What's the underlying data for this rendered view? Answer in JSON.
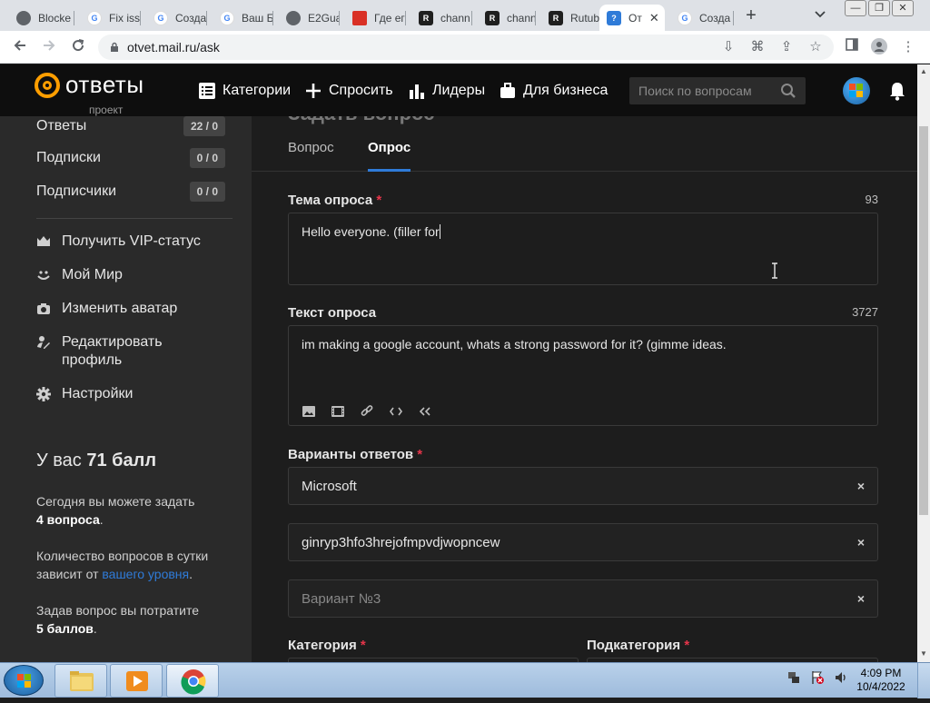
{
  "browser": {
    "tabs": [
      {
        "label": "Blocke",
        "color": "#5f6368",
        "letter": ""
      },
      {
        "label": "Fix iss",
        "color": "#4285f4",
        "letter": "G"
      },
      {
        "label": "Созда",
        "color": "#4285f4",
        "letter": "G"
      },
      {
        "label": "Ваш Б",
        "color": "#4285f4",
        "letter": "G"
      },
      {
        "label": "E2Gua",
        "color": "#5f6368",
        "letter": ""
      },
      {
        "label": "Где ег",
        "color": "#d93025",
        "letter": ""
      },
      {
        "label": "chann",
        "color": "#1f1f1f",
        "letter": "R"
      },
      {
        "label": "chann",
        "color": "#1f1f1f",
        "letter": "R"
      },
      {
        "label": "Rutub",
        "color": "#1f1f1f",
        "letter": "R"
      },
      {
        "label": "От",
        "color": "#2f7bd8",
        "letter": "?"
      },
      {
        "label": "Созда",
        "color": "#4285f4",
        "letter": "G"
      }
    ],
    "active_tab_close": "✕",
    "new_tab": "+",
    "url": "otvet.mail.ru/ask"
  },
  "header": {
    "logo_text": "ответы",
    "logo_sub": "проект",
    "nav": {
      "categories": "Категории",
      "ask": "Спросить",
      "leaders": "Лидеры",
      "business": "Для бизнеса"
    },
    "search_placeholder": "Поиск по вопросам"
  },
  "sidebar": {
    "stats": [
      {
        "label": "Ответы",
        "value": "22 / 0"
      },
      {
        "label": "Подписки",
        "value": "0 / 0"
      },
      {
        "label": "Подписчики",
        "value": "0 / 0"
      }
    ],
    "menu": {
      "vip": "Получить VIP-статус",
      "myworld": "Мой Мир",
      "avatar": "Изменить аватар",
      "edit_profile_1": "Редактировать",
      "edit_profile_2": "профиль",
      "settings": "Настройки"
    },
    "score_prefix": "У вас ",
    "score_value": "71 балл",
    "p1_a": "Сегодня вы можете задать",
    "p1_b": "4 вопроса",
    "p1_c": ".",
    "p2_a": "Количество вопросов в сутки",
    "p2_b": "зависит от ",
    "p2_link": "вашего уровня",
    "p2_c": ".",
    "p3_a": "Задав вопрос вы потратите",
    "p3_b": "5 баллов",
    "p3_c": "."
  },
  "main": {
    "page_title_peek": "Задать вопрос",
    "tabs": {
      "question": "Вопрос",
      "poll": "Опрос"
    },
    "poll_topic": {
      "label": "Тема опроса",
      "required": "*",
      "counter": "93",
      "value": "Hello everyone. (filler for"
    },
    "poll_text": {
      "label": "Текст опроса",
      "counter": "3727",
      "value": "im making a google account, whats a strong password for it? (gimme ideas."
    },
    "answers": {
      "label": "Варианты ответов",
      "required": "*",
      "items": [
        {
          "value": "Microsoft",
          "placeholder": false
        },
        {
          "value": "ginryp3hfo3hrejofmpvdjwopncew",
          "placeholder": false
        },
        {
          "value": "Вариант №3",
          "placeholder": true
        }
      ],
      "remove_glyph": "×"
    },
    "category": {
      "label": "Категория",
      "required": "*"
    },
    "subcategory": {
      "label": "Подкатегория",
      "required": "*"
    }
  },
  "taskbar": {
    "time": "4:09 PM",
    "date": "10/4/2022"
  }
}
